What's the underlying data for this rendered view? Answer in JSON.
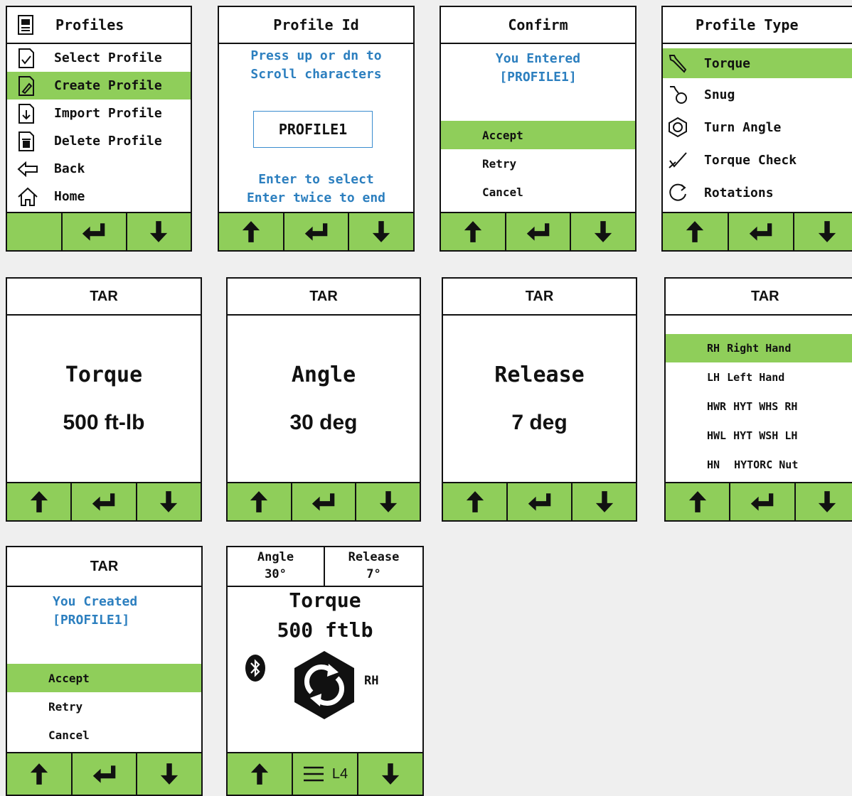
{
  "colors": {
    "accent": "#8fce5a",
    "link": "#2c7fbf",
    "background": "#efefef"
  },
  "profiles": {
    "title": "Profiles",
    "items": [
      {
        "label": "Select Profile",
        "icon": "profile-check-icon"
      },
      {
        "label": "Create Profile",
        "icon": "profile-edit-icon",
        "selected": true
      },
      {
        "label": "Import Profile",
        "icon": "profile-import-icon"
      },
      {
        "label": "Delete Profile",
        "icon": "profile-delete-icon"
      },
      {
        "label": "Back",
        "icon": "back-arrow-icon"
      },
      {
        "label": "Home",
        "icon": "home-icon"
      }
    ]
  },
  "profile_id": {
    "title": "Profile Id",
    "instruction_1": "Press up or dn to",
    "instruction_2": "Scroll characters",
    "value": "PROFILE1",
    "hint_1": "Enter to select",
    "hint_2": "Enter twice to end"
  },
  "confirm": {
    "title": "Confirm",
    "msg_1": "You Entered",
    "msg_2": "[PROFILE1]",
    "options": [
      "Accept",
      "Retry",
      "Cancel"
    ],
    "selected_index": 0
  },
  "profile_type": {
    "title": "Profile Type",
    "items": [
      {
        "label": "Torque",
        "icon": "wrench-icon",
        "selected": true
      },
      {
        "label": "Snug",
        "icon": "snug-icon"
      },
      {
        "label": "Turn Angle",
        "icon": "nut-icon"
      },
      {
        "label": "Torque Check",
        "icon": "check-wrench-icon"
      },
      {
        "label": "Rotations",
        "icon": "rotation-icon"
      }
    ]
  },
  "tar_torque": {
    "title": "TAR",
    "label": "Torque",
    "value": "500 ft-lb"
  },
  "tar_angle": {
    "title": "TAR",
    "label": "Angle",
    "value": "30 deg"
  },
  "tar_release": {
    "title": "TAR",
    "label": "Release",
    "value": "7 deg"
  },
  "tar_hand": {
    "title": "TAR",
    "options": [
      {
        "code": "RH",
        "label": "Right Hand",
        "selected": true
      },
      {
        "code": "LH",
        "label": "Left Hand"
      },
      {
        "code": "HWR",
        "label": "HYT WHS RH"
      },
      {
        "code": "HWL",
        "label": "HYT WSH LH"
      },
      {
        "code": "HN",
        "label": "HYTORC Nut"
      }
    ]
  },
  "tar_created": {
    "title": "TAR",
    "msg_1": "You Created",
    "msg_2": "[PROFILE1]",
    "options": [
      "Accept",
      "Retry",
      "Cancel"
    ],
    "selected_index": 0
  },
  "run_screen": {
    "angle_label": "Angle",
    "angle_value": "30°",
    "release_label": "Release",
    "release_value": "7°",
    "mode": "Torque",
    "torque": "500 ftlb",
    "direction": "RH",
    "layer": "L4"
  }
}
